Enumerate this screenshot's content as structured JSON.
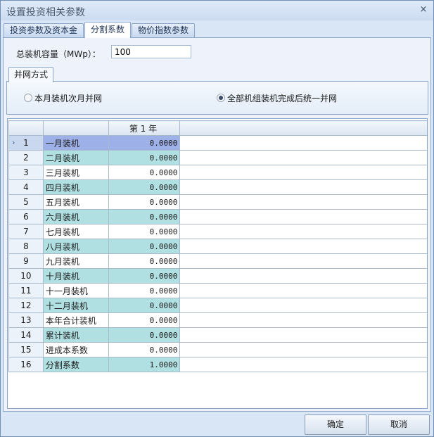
{
  "window": {
    "title": "设置投资相关参数",
    "close_glyph": "×"
  },
  "tabs": [
    {
      "label": "投资参数及资本金",
      "active": false
    },
    {
      "label": "分割系数",
      "active": true
    },
    {
      "label": "物价指数参数",
      "active": false
    }
  ],
  "capacity": {
    "label": "总装机容量（MWp）：",
    "value": "100"
  },
  "grid_mode": {
    "group_label": "并网方式",
    "options": [
      {
        "label": "本月装机次月并网",
        "selected": false
      },
      {
        "label": "全部机组装机完成后统一并网",
        "selected": true
      }
    ]
  },
  "table": {
    "column_header": "第 1 年",
    "rows": [
      {
        "no": "1",
        "name": "一月装机",
        "value": "0.0000"
      },
      {
        "no": "2",
        "name": "二月装机",
        "value": "0.0000"
      },
      {
        "no": "3",
        "name": "三月装机",
        "value": "0.0000"
      },
      {
        "no": "4",
        "name": "四月装机",
        "value": "0.0000"
      },
      {
        "no": "5",
        "name": "五月装机",
        "value": "0.0000"
      },
      {
        "no": "6",
        "name": "六月装机",
        "value": "0.0000"
      },
      {
        "no": "7",
        "name": "七月装机",
        "value": "0.0000"
      },
      {
        "no": "8",
        "name": "八月装机",
        "value": "0.0000"
      },
      {
        "no": "9",
        "name": "九月装机",
        "value": "0.0000"
      },
      {
        "no": "10",
        "name": "十月装机",
        "value": "0.0000"
      },
      {
        "no": "11",
        "name": "十一月装机",
        "value": "0.0000"
      },
      {
        "no": "12",
        "name": "十二月装机",
        "value": "0.0000"
      },
      {
        "no": "13",
        "name": "本年合计装机",
        "value": "0.0000"
      },
      {
        "no": "14",
        "name": "累计装机",
        "value": "0.0000"
      },
      {
        "no": "15",
        "name": "进成本系数",
        "value": "0.0000"
      },
      {
        "no": "16",
        "name": "分割系数",
        "value": "1.0000"
      }
    ],
    "selected_row_indicator": "›"
  },
  "buttons": {
    "ok": "确定",
    "cancel": "取消"
  }
}
